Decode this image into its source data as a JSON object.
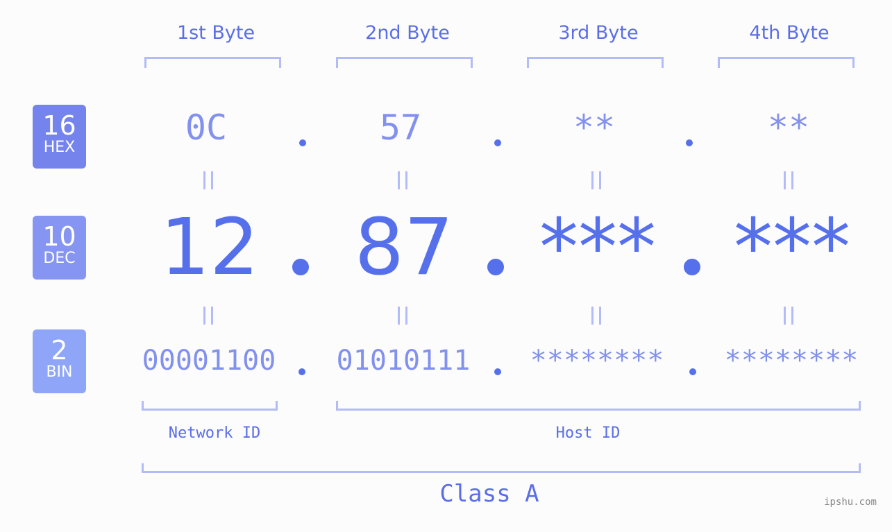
{
  "colors": {
    "background": "#fbfcfb",
    "accent": "#5670ec",
    "light_accent": "#8290ee",
    "bracket": "#b3bcf6",
    "hex_badge": "#7584ed",
    "dec_badge": "#8595f1",
    "bin_badge": "#8fa6f8"
  },
  "byte_headers": [
    "1st Byte",
    "2nd Byte",
    "3rd Byte",
    "4th Byte"
  ],
  "badges": {
    "hex": {
      "number": "16",
      "label": "HEX"
    },
    "dec": {
      "number": "10",
      "label": "DEC"
    },
    "bin": {
      "number": "2",
      "label": "BIN"
    }
  },
  "hex_values": [
    "0C",
    "57",
    "**",
    "**"
  ],
  "dec_values": [
    "12",
    "87",
    "***",
    "***"
  ],
  "bin_values": [
    "00001100",
    "01010111",
    "********",
    "********"
  ],
  "labels": {
    "network_id": "Network ID",
    "host_id": "Host ID",
    "class": "Class A"
  },
  "watermark": "ipshu.com"
}
